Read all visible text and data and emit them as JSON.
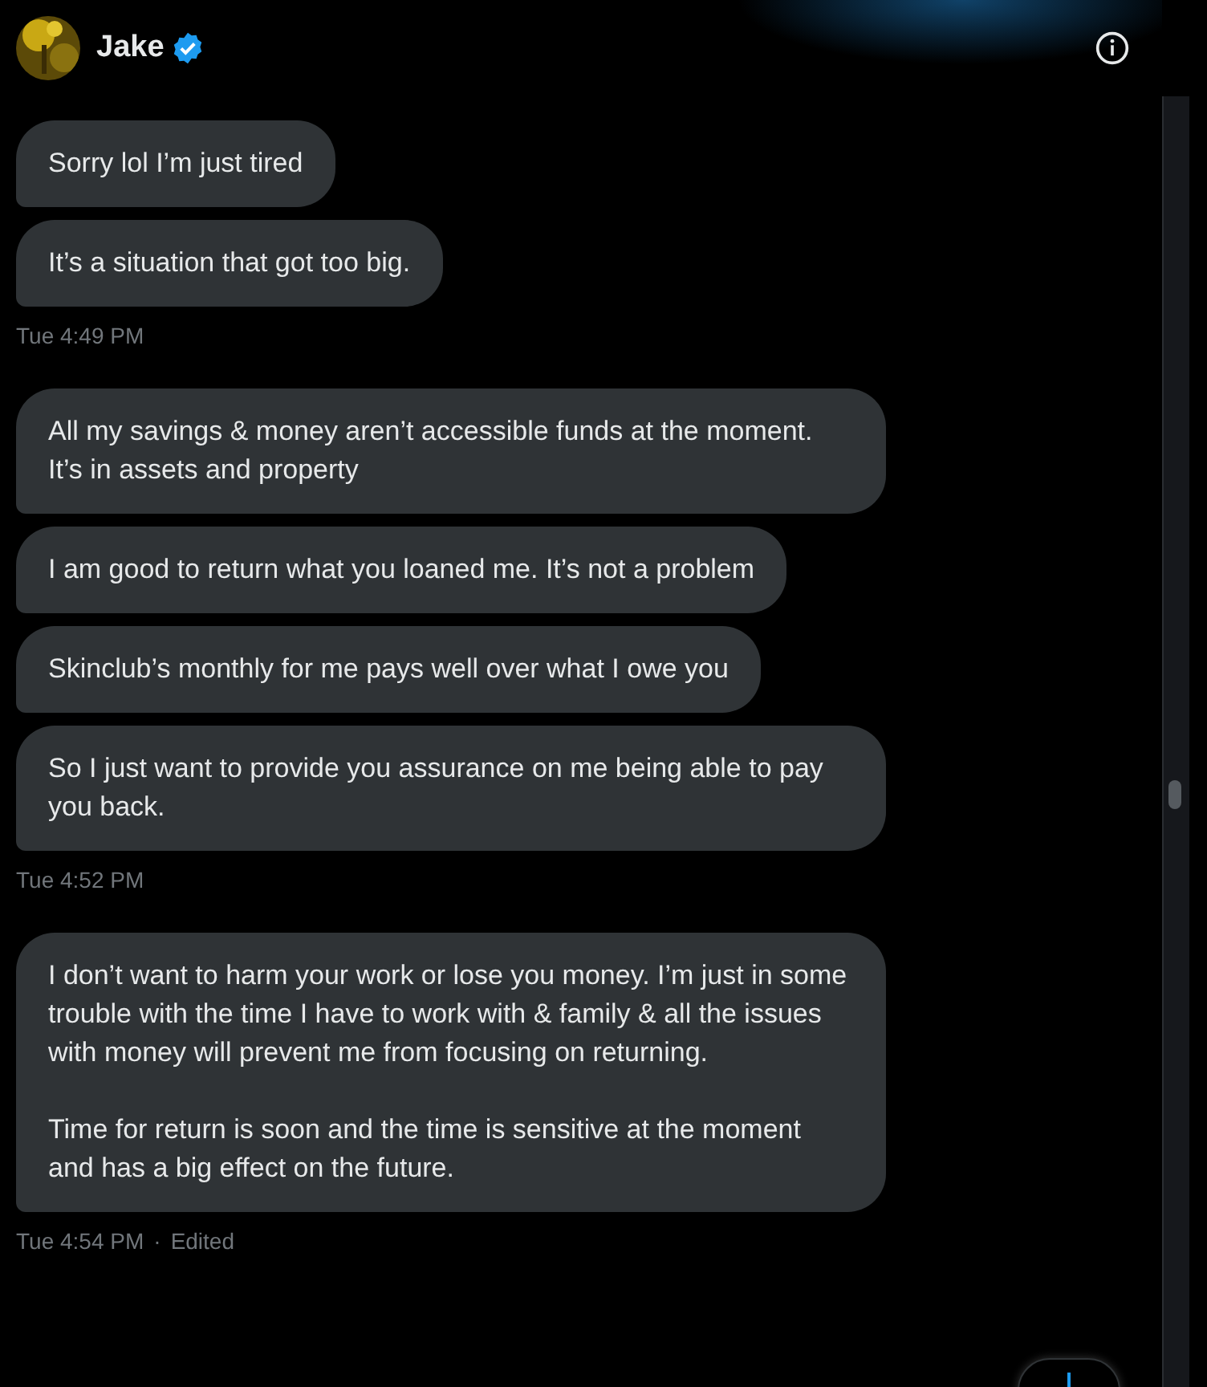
{
  "header": {
    "name": "Jake",
    "verified": true
  },
  "groups": [
    {
      "messages": [
        "Sorry lol I’m just tired",
        "It’s a situation that got too big."
      ],
      "time": "Tue 4:49 PM"
    },
    {
      "messages": [
        "All my savings & money aren’t accessible funds at the moment. It’s in assets and property",
        "I am good to return what you loaned me. It’s not a problem",
        "Skinclub’s monthly for me pays well over what I owe you",
        "So I just want to provide you assurance on me being able to pay you back."
      ],
      "time": "Tue 4:52 PM"
    },
    {
      "messages": [
        "I don’t want to harm your work or lose you money. I’m just in some trouble with the time I have to work with & family & all the issues with money will prevent me from focusing on returning.\n\nTime for return is soon and the time is sensitive at the moment and has a big effect on the future."
      ],
      "time": "Tue 4:54 PM",
      "separator": "·",
      "edited": "Edited"
    }
  ]
}
